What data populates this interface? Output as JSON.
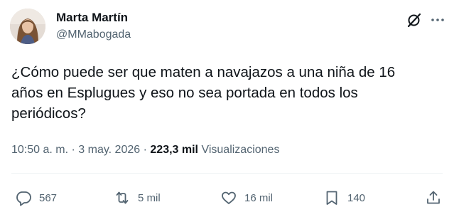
{
  "author": {
    "name": "Marta Martín",
    "handle": "@MMabogada",
    "avatar_icon": "avatar-photo"
  },
  "header_icons": [
    "grok-icon",
    "more-icon"
  ],
  "tweet": {
    "text": "¿Cómo puede ser que maten a navajazos a una niña de 16\naños en Esplugues y eso no sea portada en todos los\nperiódicos?"
  },
  "meta": {
    "time": "10:50 a. m.",
    "separator": "·",
    "date": "3 may. 2026",
    "views_count": "223,3 mil",
    "views_label": "Visualizaciones"
  },
  "actions": {
    "replies": "567",
    "reposts": "5 mil",
    "likes": "16 mil",
    "bookmarks": "140"
  },
  "colors": {
    "text_primary": "#0f1419",
    "text_secondary": "#536471",
    "divider": "#eff3f4"
  }
}
